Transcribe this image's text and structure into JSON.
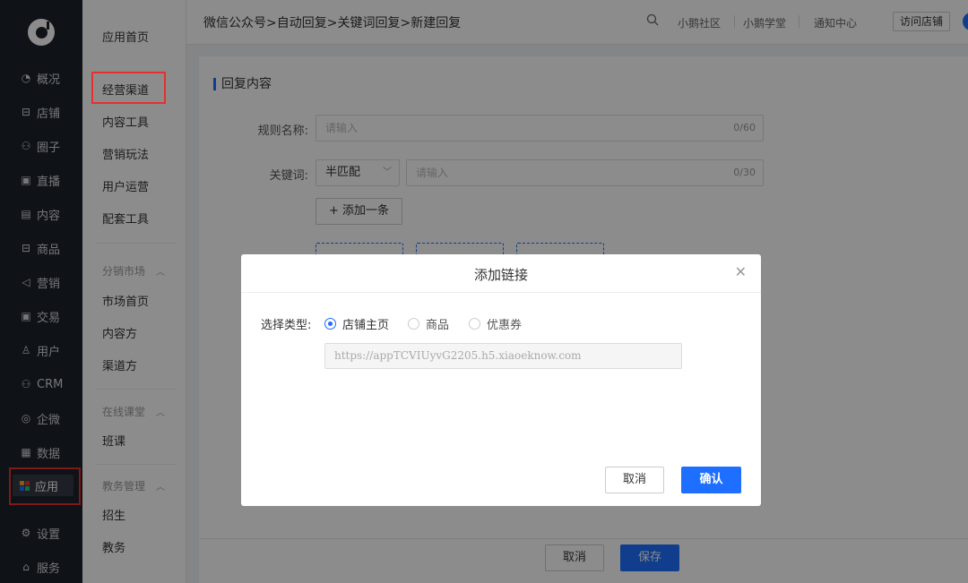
{
  "sidebar": {
    "items": [
      {
        "label": "概况",
        "icon": "pie-chart-icon",
        "glyph": "◔"
      },
      {
        "label": "店铺",
        "icon": "store-icon",
        "glyph": "⊟"
      },
      {
        "label": "圈子",
        "icon": "community-icon",
        "glyph": "⚇"
      },
      {
        "label": "直播",
        "icon": "live-icon",
        "glyph": "▣"
      },
      {
        "label": "内容",
        "icon": "document-icon",
        "glyph": "▤"
      },
      {
        "label": "商品",
        "icon": "goods-icon",
        "glyph": "⊟"
      },
      {
        "label": "营销",
        "icon": "megaphone-icon",
        "glyph": "◁"
      },
      {
        "label": "交易",
        "icon": "transaction-icon",
        "glyph": "▣"
      },
      {
        "label": "用户",
        "icon": "user-icon",
        "glyph": "♙"
      },
      {
        "label": "CRM",
        "icon": "crm-icon",
        "glyph": "⚇"
      },
      {
        "label": "企微",
        "icon": "wecom-icon",
        "glyph": "◎"
      },
      {
        "label": "数据",
        "icon": "data-icon",
        "glyph": "▦"
      },
      {
        "label": "应用",
        "icon": "app-grid-icon",
        "glyph": ""
      },
      {
        "label": "设置",
        "icon": "gear-icon",
        "glyph": "⚙"
      },
      {
        "label": "服务",
        "icon": "service-icon",
        "glyph": "⌂"
      }
    ],
    "active_label": "应用",
    "app_dot_colors": [
      "#f5a623",
      "#e5302f",
      "#1e6fff",
      "#2fbf71"
    ]
  },
  "submenu": {
    "home": "应用首页",
    "items": [
      "经营渠道",
      "内容工具",
      "营销玩法",
      "用户运营",
      "配套工具"
    ],
    "selected": "经营渠道",
    "groups": [
      {
        "title": "分销市场",
        "items": [
          "市场首页",
          "内容方",
          "渠道方"
        ]
      },
      {
        "title": "在线课堂",
        "items": [
          "班课"
        ]
      },
      {
        "title": "教务管理",
        "items": [
          "招生",
          "教务"
        ]
      }
    ]
  },
  "header": {
    "breadcrumb": "微信公众号>自动回复>关键词回复>新建回复",
    "links": [
      "小鹅社区",
      "小鹅学堂",
      "通知中心"
    ],
    "visit_store": "访问店铺",
    "accent": "#1e6fff"
  },
  "form": {
    "section_title": "回复内容",
    "rule_name_label": "规则名称:",
    "rule_name_placeholder": "请输入",
    "rule_name_count": "0/60",
    "keyword_label": "关键词:",
    "match_mode": "半匹配",
    "keyword_placeholder": "请输入",
    "keyword_count": "0/30",
    "add_one": "+ 添加一条",
    "cancel": "取消",
    "save": "保存"
  },
  "modal": {
    "title": "添加链接",
    "type_label": "选择类型:",
    "options": [
      "店铺主页",
      "商品",
      "优惠券"
    ],
    "selected_option": "店铺主页",
    "url": "https://appTCVIUyvG2205.h5.xiaoeknow.com",
    "cancel": "取消",
    "confirm": "确认"
  }
}
